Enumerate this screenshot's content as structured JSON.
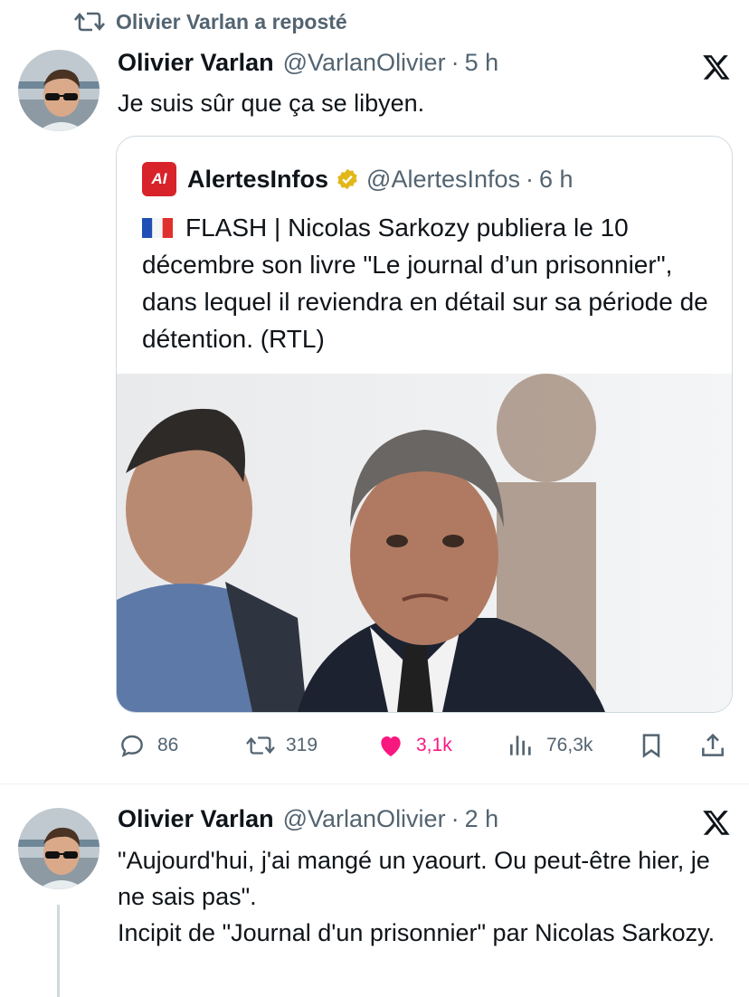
{
  "repost_header": {
    "icon": "repost-icon",
    "label": "Olivier Varlan a reposté"
  },
  "tweet1": {
    "name": "Olivier Varlan",
    "handle": "@VarlanOlivier",
    "sep": "·",
    "time": "5 h",
    "text": "Je suis sûr que ça se libyen."
  },
  "quote": {
    "logo_text": "AI",
    "name": "AlertesInfos",
    "handle": "@AlertesInfos",
    "sep": "·",
    "time": "6 h",
    "text": "FLASH | Nicolas Sarkozy publiera le 10 décembre son livre \"Le journal d’un prisonnier\", dans lequel il reviendra en détail sur sa période de détention. (RTL)"
  },
  "actions": {
    "replies": "86",
    "reposts": "319",
    "likes": "3,1k",
    "views": "76,3k"
  },
  "tweet2": {
    "name": "Olivier Varlan",
    "handle": "@VarlanOlivier",
    "sep": "·",
    "time": "2 h",
    "text_line1": "\"Aujourd'hui, j'ai mangé un yaourt. Ou peut-être hier, je ne sais pas\".",
    "text_line2": "Incipit de \"Journal d'un prisonnier\" par Nicolas Sarkozy."
  },
  "colors": {
    "secondary_text": "#536471",
    "like_pink": "#f91880",
    "verified_gold": "#e2b719",
    "brand_red": "#d8232a",
    "border": "#cfd9de"
  }
}
